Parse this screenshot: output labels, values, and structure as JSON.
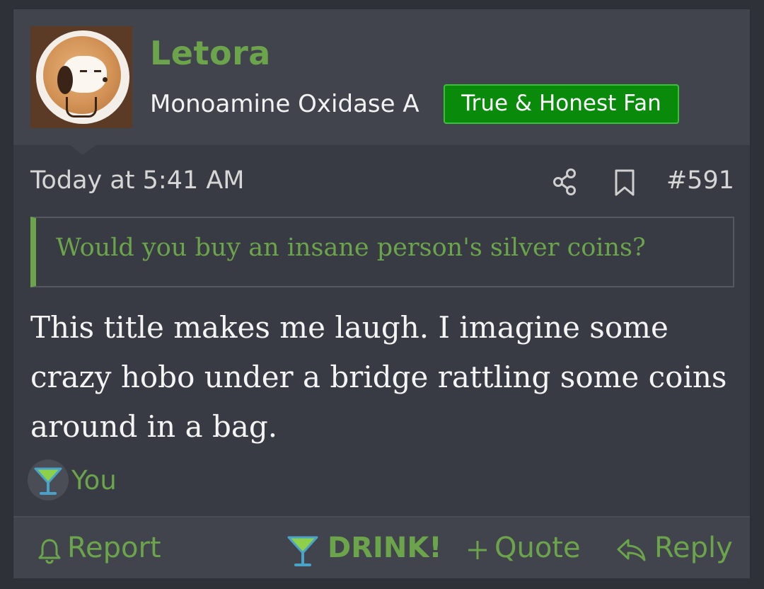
{
  "post": {
    "username": "Letora",
    "user_title": "Monoamine Oxidase A",
    "badge": "True & Honest Fan",
    "timestamp": "Today at 5:41 AM",
    "post_number": "#591",
    "quote_text": "Would you buy an insane person's silver coins?",
    "body_text": "This title makes me laugh. I imagine some crazy hobo under a bridge rattling some coins around in a bag.",
    "reaction": {
      "icon": "cocktail-icon",
      "user": "You"
    }
  },
  "actions": {
    "report": "Report",
    "drink": "DRINK!",
    "quote": "Quote",
    "reply": "Reply"
  },
  "colors": {
    "accent": "#6ba44a",
    "badge_bg": "#0a8a0a",
    "card_bg": "#383b43",
    "header_bg": "#41444c"
  }
}
